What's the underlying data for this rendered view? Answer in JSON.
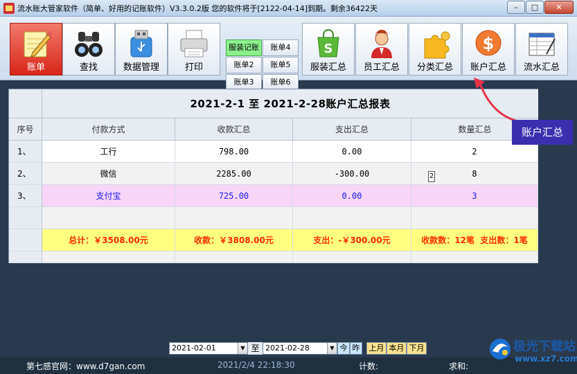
{
  "window": {
    "title": "流水账大管家软件（简单、好用的记账软件）V3.3.0.2版 您的软件将于[2122-04-14]到期。剩余36422天",
    "minimize": "–",
    "maximize": "□",
    "close": "✕"
  },
  "toolbar": {
    "main_buttons": [
      {
        "label": "账单",
        "icon": "notepad-pencil-icon",
        "active": true
      },
      {
        "label": "查找",
        "icon": "binoculars-icon"
      },
      {
        "label": "数据管理",
        "icon": "usb-drive-icon"
      },
      {
        "label": "打印",
        "icon": "printer-icon"
      }
    ],
    "accounts": [
      "服装记账",
      "账单4",
      "账单2",
      "账单5",
      "账单3",
      "账单6"
    ],
    "summary_buttons": [
      {
        "label": "服装汇总",
        "icon": "shopping-bag-icon"
      },
      {
        "label": "员工汇总",
        "icon": "person-icon"
      },
      {
        "label": "分类汇总",
        "icon": "puzzle-icon"
      },
      {
        "label": "账户汇总",
        "icon": "dollar-coin-icon"
      },
      {
        "label": "流水汇总",
        "icon": "ledger-icon"
      }
    ]
  },
  "report": {
    "title": "2021-2-1 至 2021-2-28账户汇总报表",
    "columns": [
      "序号",
      "付款方式",
      "收款汇总",
      "支出汇总",
      "数量汇总"
    ],
    "rows": [
      {
        "no": "1、",
        "method": "工行",
        "income": "798.00",
        "expense": "0.00",
        "count": "2"
      },
      {
        "no": "2、",
        "method": "微信",
        "income": "2285.00",
        "expense": "-300.00",
        "count": "8"
      },
      {
        "no": "3、",
        "method": "支付宝",
        "income": "725.00",
        "expense": "0.00",
        "count": "3"
      }
    ],
    "totals": {
      "total": "总计：￥3508.00元",
      "income": "收款：￥3808.00元",
      "expense": "支出：-￥300.00元",
      "counts": "收款数：12笔  支出数：1笔"
    },
    "tooltip": "2"
  },
  "callout": "账户汇总",
  "datebar": {
    "from": "2021-02-01",
    "to_label": "至",
    "to": "2021-02-28",
    "today": "今",
    "yesterday": "昨",
    "last_month": "上月",
    "this_month": "本月",
    "next_month": "下月"
  },
  "statusbar": {
    "website": "第七感官网：www.d7gan.com",
    "datetime": "2021/2/4 22:18:30",
    "count_label": "计数:",
    "sum_label": "求和:"
  },
  "watermark": {
    "name": "极光下载站",
    "url": "www.xz7.com"
  }
}
